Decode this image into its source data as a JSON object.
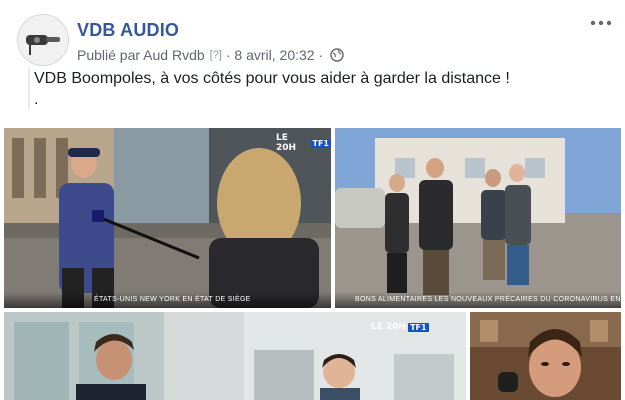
{
  "post": {
    "page_name": "VDB AUDIO",
    "published_by": "Publié par Aud Rvdb",
    "help": "[?]",
    "date": "· 8 avril, 20:32 ·",
    "text_line1": "VDB Boompoles, à vos côtés pour vous aider à garder la distance !",
    "text_line2": "."
  },
  "media": {
    "tile1": {
      "logo": "LE 20H",
      "logo_badge": "TF1",
      "caption": "ÉTATS-UNIS  NEW YORK EN ÉTAT DE SIÈGE"
    },
    "tile2": {
      "caption": "BONS ALIMENTAIRES  LES NOUVEAUX PRÉCAIRES DU CORONAVIRUS EN ITALIE"
    },
    "tile3": {
      "logo": "LE 20H",
      "logo_badge": "TF1"
    }
  },
  "icons": [
    "avatar-logo",
    "globe-icon",
    "more-options-icon"
  ],
  "colors": {
    "page_name": "#365899",
    "meta": "#616770",
    "text": "#1c1e21"
  }
}
